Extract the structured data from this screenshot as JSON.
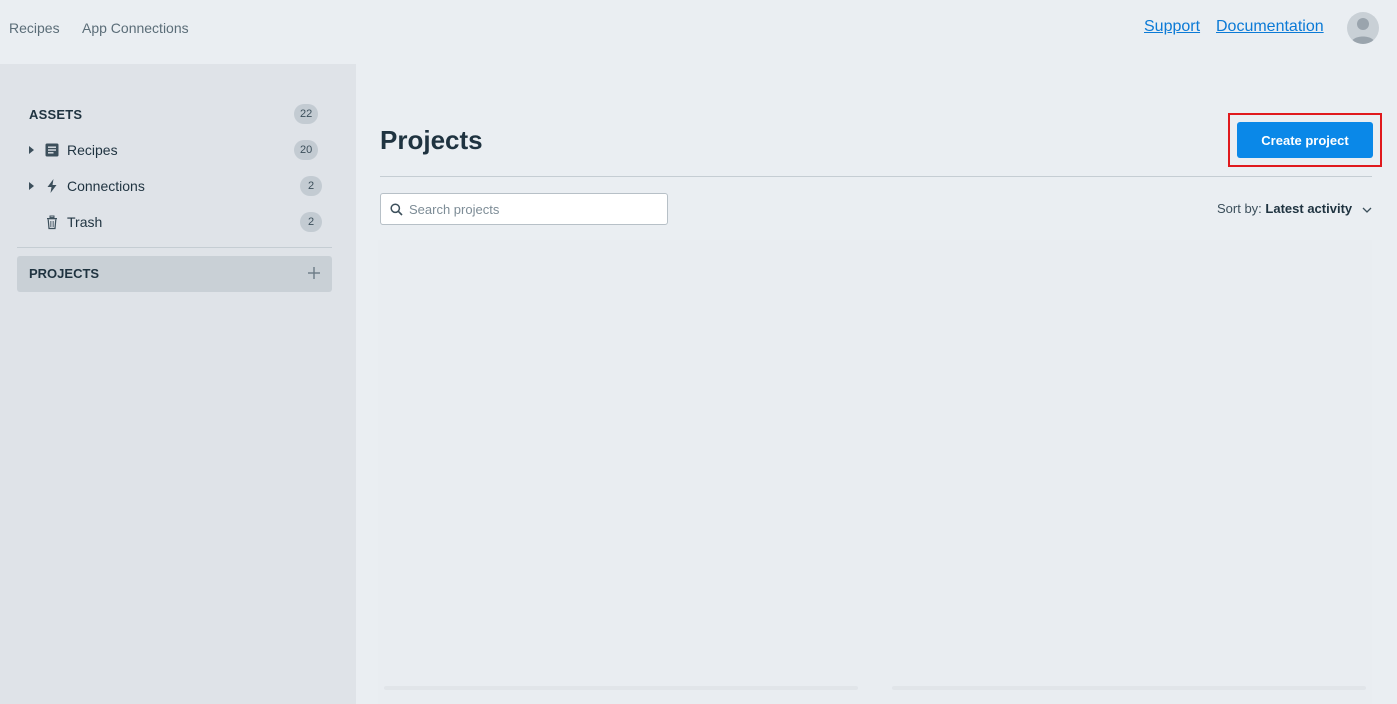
{
  "topnav": {
    "items": [
      "Recipes",
      "App Connections"
    ],
    "links": [
      "Support",
      "Documentation"
    ]
  },
  "sidebar": {
    "assets_header": "ASSETS",
    "assets_count": "22",
    "items": [
      {
        "label": "Recipes",
        "count": "20",
        "icon": "recipe-list-icon"
      },
      {
        "label": "Connections",
        "count": "2",
        "icon": "lightning-bolt-icon"
      },
      {
        "label": "Trash",
        "count": "2",
        "icon": "trash-icon"
      }
    ],
    "projects_header": "PROJECTS"
  },
  "main": {
    "title": "Projects",
    "create_button": "Create project",
    "search_placeholder": "Search projects",
    "sort_label": "Sort by:",
    "sort_value": "Latest activity"
  },
  "colors": {
    "primary": "#0a88e8",
    "link": "#0b7ad6",
    "highlight": "#e0191d"
  }
}
